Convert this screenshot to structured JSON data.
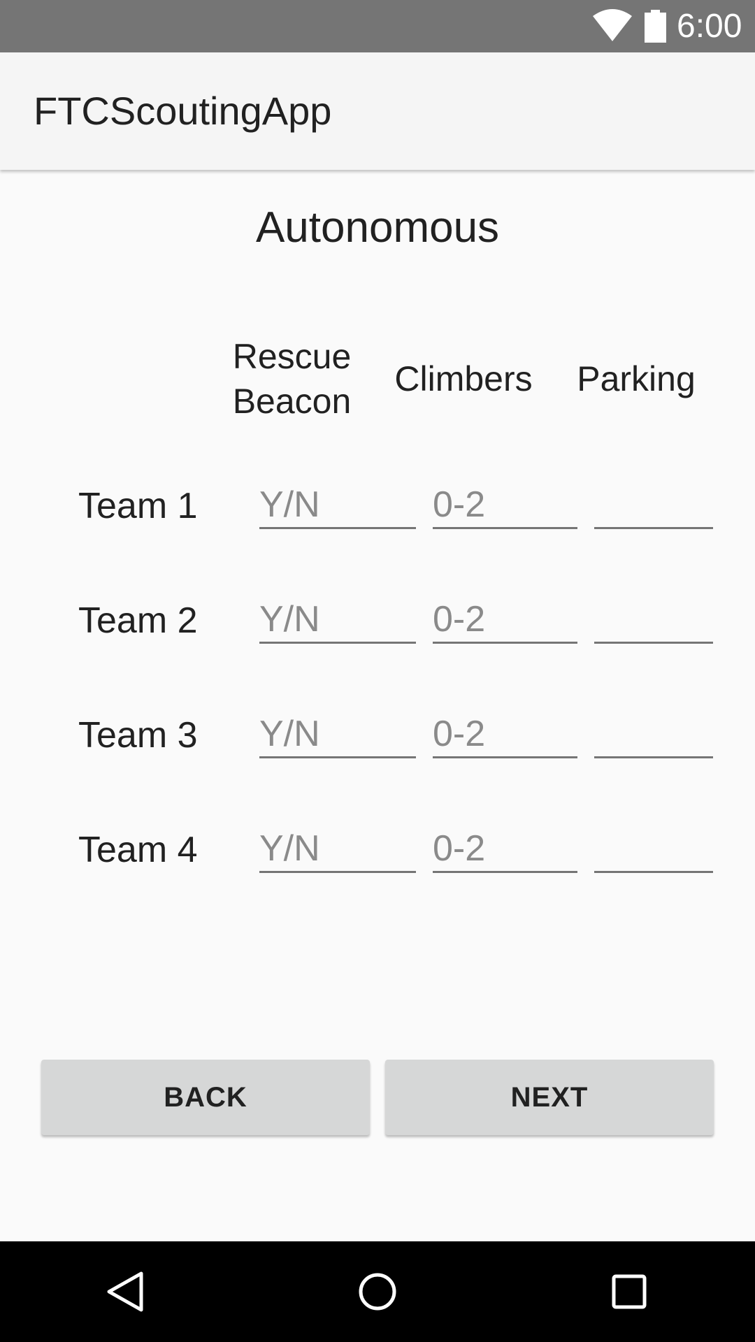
{
  "status_bar": {
    "time": "6:00",
    "icons": [
      "wifi-icon",
      "battery-icon"
    ]
  },
  "app_bar": {
    "title": "FTCScoutingApp"
  },
  "screen": {
    "section_title": "Autonomous",
    "columns": {
      "rescue_line1": "Rescue",
      "rescue_line2": "Beacon",
      "climbers": "Climbers",
      "parking": "Parking"
    },
    "rows": [
      {
        "label": "Team 1",
        "rescue_placeholder": "Y/N",
        "climbers_placeholder": "0-2",
        "parking_placeholder": ""
      },
      {
        "label": "Team 2",
        "rescue_placeholder": "Y/N",
        "climbers_placeholder": "0-2",
        "parking_placeholder": ""
      },
      {
        "label": "Team 3",
        "rescue_placeholder": "Y/N",
        "climbers_placeholder": "0-2",
        "parking_placeholder": ""
      },
      {
        "label": "Team 4",
        "rescue_placeholder": "Y/N",
        "climbers_placeholder": "0-2",
        "parking_placeholder": ""
      }
    ]
  },
  "buttons": {
    "back_label": "BACK",
    "next_label": "NEXT"
  },
  "nav_bar": {
    "icons": [
      "back-triangle-icon",
      "home-circle-icon",
      "recent-apps-square-icon"
    ]
  },
  "colors": {
    "status_bar": "#757575",
    "app_bar": "#f5f5f5",
    "background": "#fafafa",
    "button": "#d6d7d7",
    "nav_bar": "#000000",
    "hint_text": "#8a8a8a",
    "underline": "#757575"
  }
}
